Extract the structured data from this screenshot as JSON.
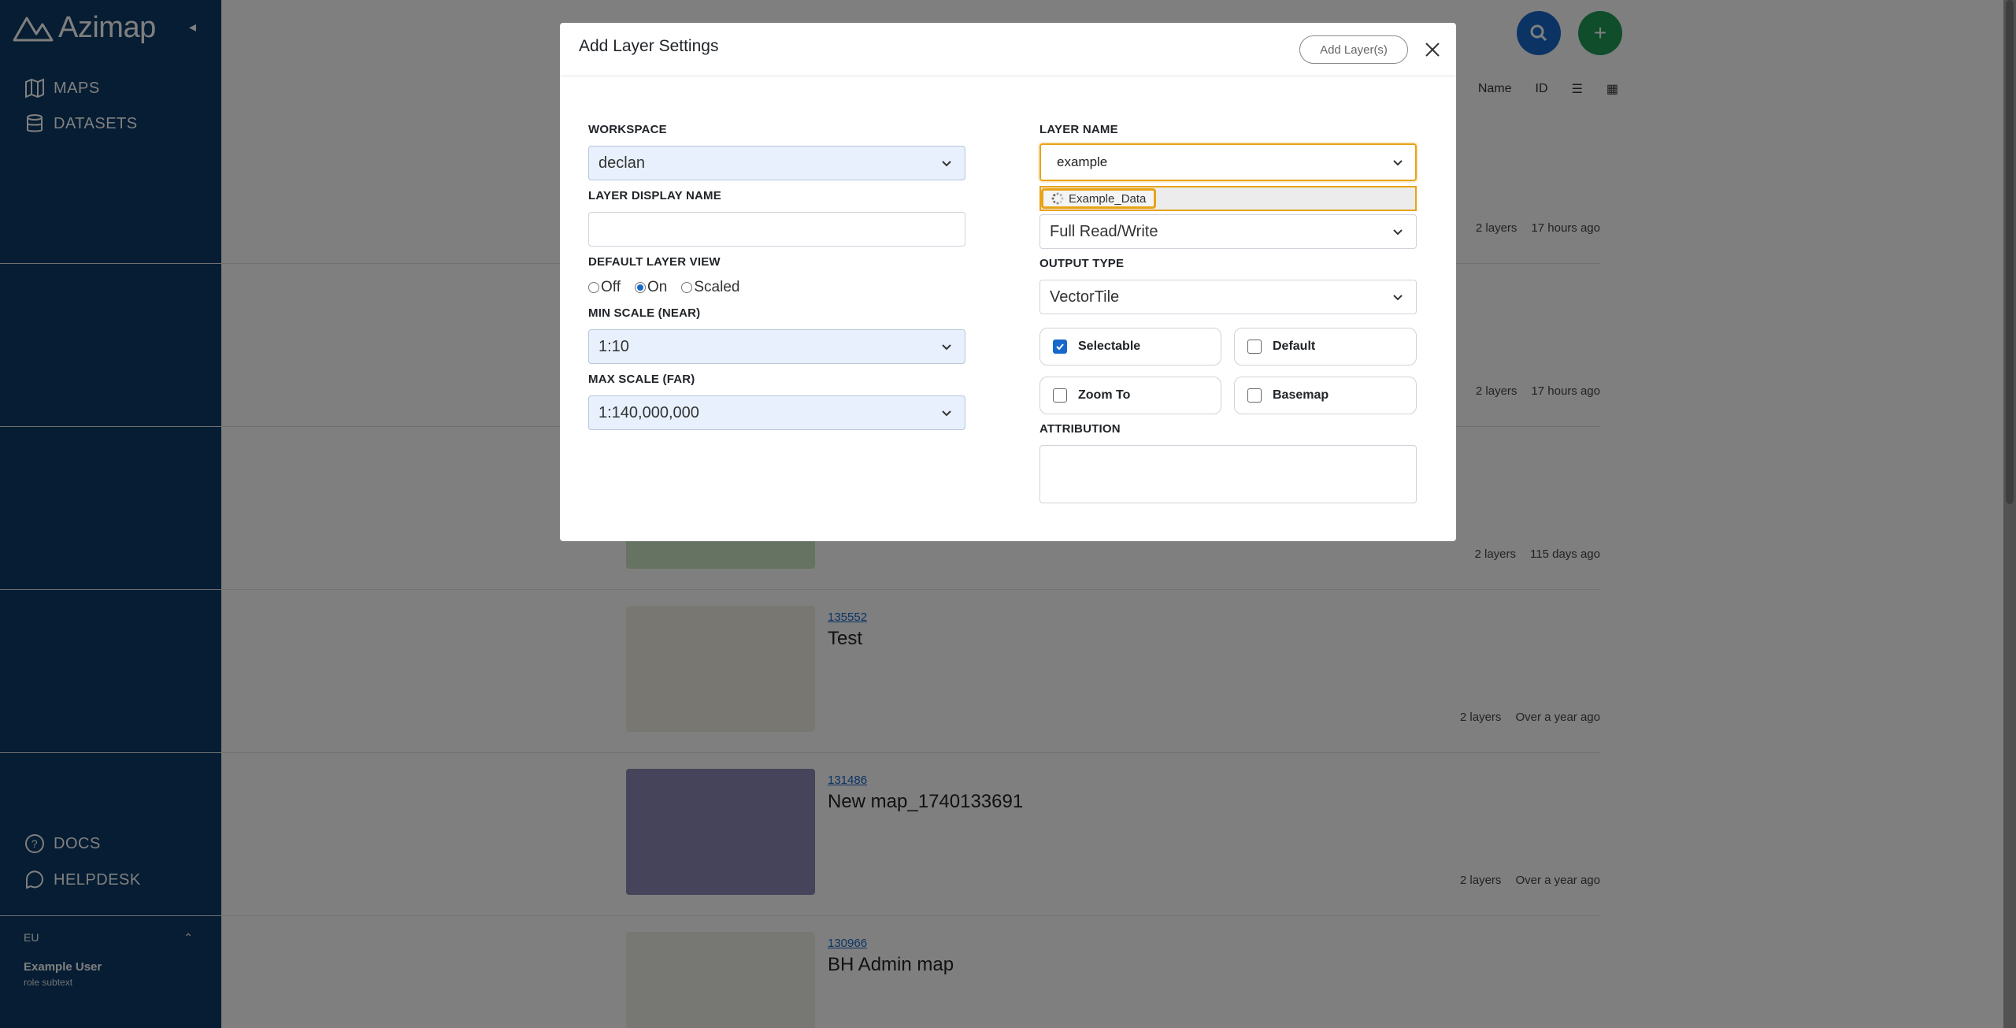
{
  "sidebar": {
    "brand": "Azimap",
    "collapse_icon": "chevron-left",
    "nav": [
      {
        "label": "MAPS",
        "icon": "map-icon"
      },
      {
        "label": "DATASETS",
        "icon": "database-icon"
      }
    ],
    "bottom_nav": [
      {
        "label": "DOCS",
        "icon": "help-circle-icon"
      },
      {
        "label": "HELPDESK",
        "icon": "chat-icon"
      }
    ],
    "user": {
      "initials": "EU",
      "name": "Example User",
      "role": "role subtext"
    }
  },
  "background": {
    "maps": [
      {
        "id": "",
        "name": "",
        "layers": "2 layers",
        "updated": "17 hours ago",
        "thumb_color": "#e4ecf2"
      },
      {
        "id": "",
        "name": "",
        "layers": "2 layers",
        "updated": "17 hours ago",
        "thumb_color": "#e4ecf2"
      },
      {
        "id": "",
        "name": "",
        "layers": "2 layers",
        "updated": "115 days ago",
        "thumb_color": "#cfe6c5"
      },
      {
        "id": "135552",
        "name": "Test",
        "layers": "2 layers",
        "updated": "Over a year ago",
        "thumb_color": "#f1eee5"
      },
      {
        "id": "131486",
        "name": "New map_1740133691",
        "layers": "2 layers",
        "updated": "Over a year ago",
        "thumb_color": "#8a88b5"
      },
      {
        "id": "130966",
        "name": "BH Admin map",
        "layers": "",
        "updated": "",
        "thumb_color": "#eef0e8"
      }
    ]
  },
  "modal": {
    "title": "Add Layer Settings",
    "add_button": "Add Layer(s)",
    "workspace": {
      "label": "WORKSPACE",
      "value": "declan"
    },
    "layer_display_name": {
      "label": "LAYER DISPLAY NAME",
      "value": ""
    },
    "default_layer_view": {
      "label": "DEFAULT LAYER VIEW",
      "options": [
        "Off",
        "On",
        "Scaled"
      ],
      "selected": "On"
    },
    "min_scale": {
      "label": "MIN SCALE (NEAR)",
      "value": "1:10"
    },
    "max_scale": {
      "label": "MAX SCALE (FAR)",
      "value": "1:140,000,000"
    },
    "layer_name": {
      "label": "LAYER NAME",
      "value": "example",
      "options": [
        "Example_Data"
      ]
    },
    "permission": {
      "value": "Full Read/Write"
    },
    "output_type": {
      "label": "OUTPUT TYPE",
      "value": "VectorTile"
    },
    "checkboxes": [
      {
        "label": "Selectable",
        "checked": true
      },
      {
        "label": "Default",
        "checked": false
      },
      {
        "label": "Zoom To",
        "checked": false
      },
      {
        "label": "Basemap",
        "checked": false
      }
    ],
    "attribution": {
      "label": "ATTRIBUTION",
      "value": ""
    }
  },
  "colors": {
    "sidebar": "#0d3b66",
    "primary": "#1769c9",
    "success": "#1e9a57",
    "focus": "#e8a317"
  }
}
